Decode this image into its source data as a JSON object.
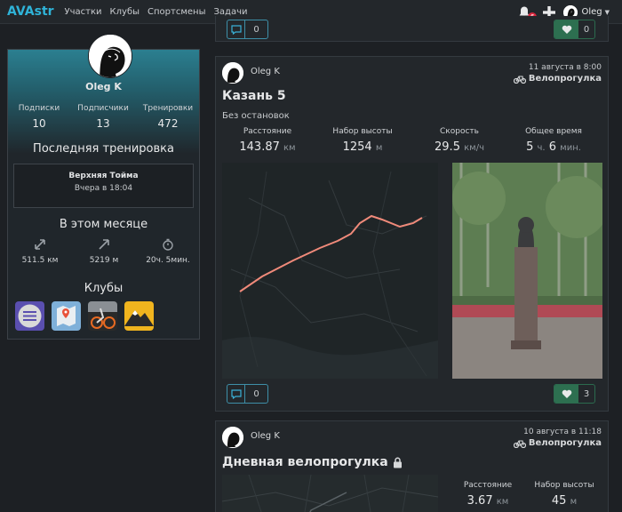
{
  "navbar": {
    "brand": "AVAstr",
    "links": [
      "Участки",
      "Клубы",
      "Спортсмены",
      "Задачи"
    ],
    "notifications_count": "6",
    "user_name": "Oleg"
  },
  "profile": {
    "name": "Oleg K",
    "stats": [
      {
        "label": "Подписки",
        "value": "10"
      },
      {
        "label": "Подписчики",
        "value": "13"
      },
      {
        "label": "Тренировки",
        "value": "472"
      }
    ],
    "last_training_heading": "Последняя тренировка",
    "last_training_title": "Верхняя Тойма",
    "last_training_time": "Вчера в 18:04",
    "month_heading": "В этом месяце",
    "month_stats": [
      {
        "icon": "distance-icon",
        "value": "511.5 км"
      },
      {
        "icon": "elevation-icon",
        "value": "5219 м"
      },
      {
        "icon": "stopwatch-icon",
        "value": "20ч. 5мин."
      }
    ],
    "clubs_heading": "Клубы"
  },
  "prev_card": {
    "comments": "0",
    "likes": "0"
  },
  "main_card": {
    "user": "Oleg K",
    "date": "11 августа в 8:00",
    "type": "Велопрогулка",
    "title": "Казань 5",
    "subtitle": "Без остановок",
    "metrics": [
      {
        "label": "Расстояние",
        "value": "143.87",
        "unit": "км"
      },
      {
        "label": "Набор высоты",
        "value": "1254",
        "unit": "м"
      },
      {
        "label": "Скорость",
        "value": "29.5",
        "unit": "км/ч"
      },
      {
        "label": "Общее время",
        "value": "5",
        "unit": "ч.",
        "value2": "6",
        "unit2": "мин."
      }
    ],
    "comments": "0",
    "likes": "3"
  },
  "next_card": {
    "user": "Oleg K",
    "date": "10 августа в 11:18",
    "type": "Велопрогулка",
    "title": "Дневная велопрогулка",
    "metrics": [
      {
        "label": "Расстояние",
        "value": "3.67",
        "unit": "км"
      },
      {
        "label": "Набор высоты",
        "value": "45",
        "unit": "м"
      }
    ]
  },
  "colors": {
    "accent": "#2fb3d8",
    "like": "#2d6f50",
    "route": "#f08a7a"
  }
}
